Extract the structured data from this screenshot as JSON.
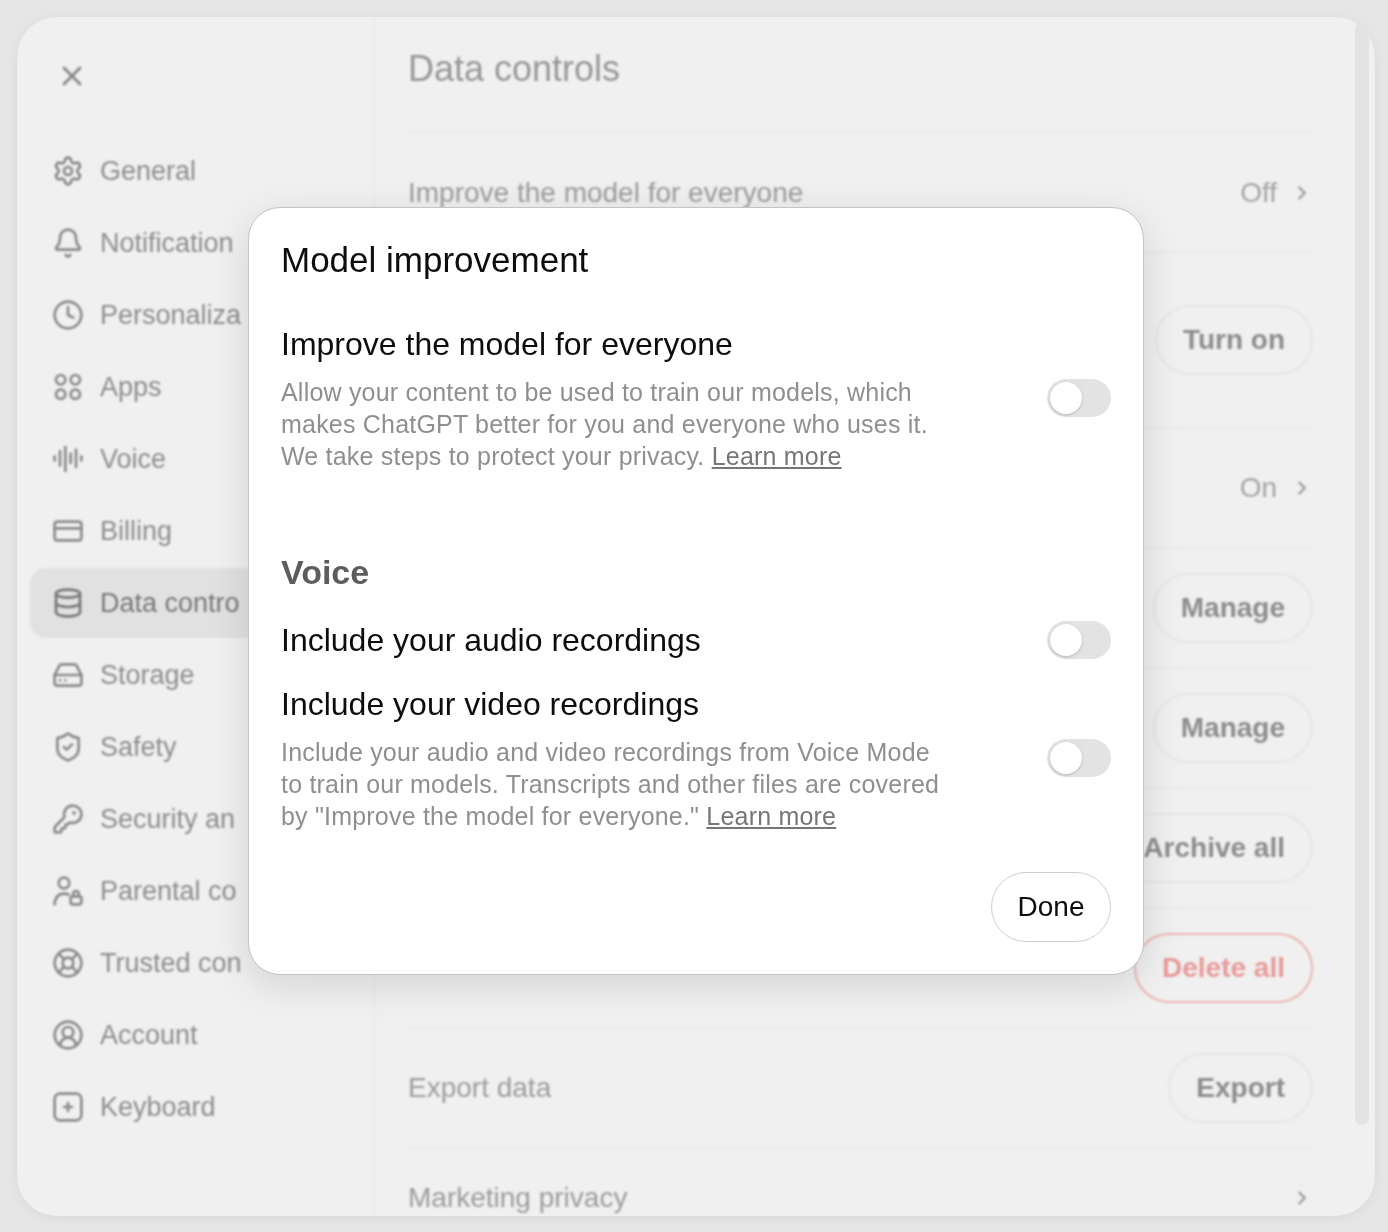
{
  "sidebar": {
    "items": [
      {
        "label": "General",
        "selected": false
      },
      {
        "label": "Notification",
        "selected": false
      },
      {
        "label": "Personaliza",
        "selected": false
      },
      {
        "label": "Apps",
        "selected": false
      },
      {
        "label": "Voice",
        "selected": false
      },
      {
        "label": "Billing",
        "selected": false
      },
      {
        "label": "Data contro",
        "selected": true
      },
      {
        "label": "Storage",
        "selected": false
      },
      {
        "label": "Safety",
        "selected": false
      },
      {
        "label": "Security an",
        "selected": false
      },
      {
        "label": "Parental co",
        "selected": false
      },
      {
        "label": "Trusted con",
        "selected": false
      },
      {
        "label": "Account",
        "selected": false
      },
      {
        "label": "Keyboard",
        "selected": false
      }
    ]
  },
  "content": {
    "title": "Data controls",
    "rows": [
      {
        "kind": "link",
        "label": "Improve the model for everyone",
        "value": "Off"
      },
      {
        "kind": "button",
        "button": "Turn on"
      },
      {
        "kind": "link",
        "value": "On"
      },
      {
        "kind": "button",
        "button": "Manage"
      },
      {
        "kind": "button",
        "button": "Manage"
      },
      {
        "kind": "button",
        "button": "Archive all"
      },
      {
        "kind": "danger_button",
        "button": "Delete all"
      },
      {
        "kind": "button",
        "label": "Export data",
        "button": "Export"
      },
      {
        "kind": "link",
        "label": "Marketing privacy"
      }
    ]
  },
  "dialog": {
    "title": "Model improvement",
    "sections": [
      {
        "items": [
          {
            "label": "Improve the model for everyone",
            "description": "Allow your content to be used to train our models, which makes ChatGPT better for you and everyone who uses it. We take steps to protect your privacy.",
            "link": "Learn more",
            "on": false
          }
        ]
      },
      {
        "heading": "Voice",
        "items": [
          {
            "label": "Include your audio recordings",
            "on": false
          },
          {
            "label": "Include your video recordings",
            "description": "Include your audio and video recordings from Voice Mode to train our models. Transcripts and other files are covered by \"Improve the model for everyone.\"",
            "link": "Learn more",
            "on": false
          }
        ]
      }
    ],
    "done_button": "Done"
  }
}
